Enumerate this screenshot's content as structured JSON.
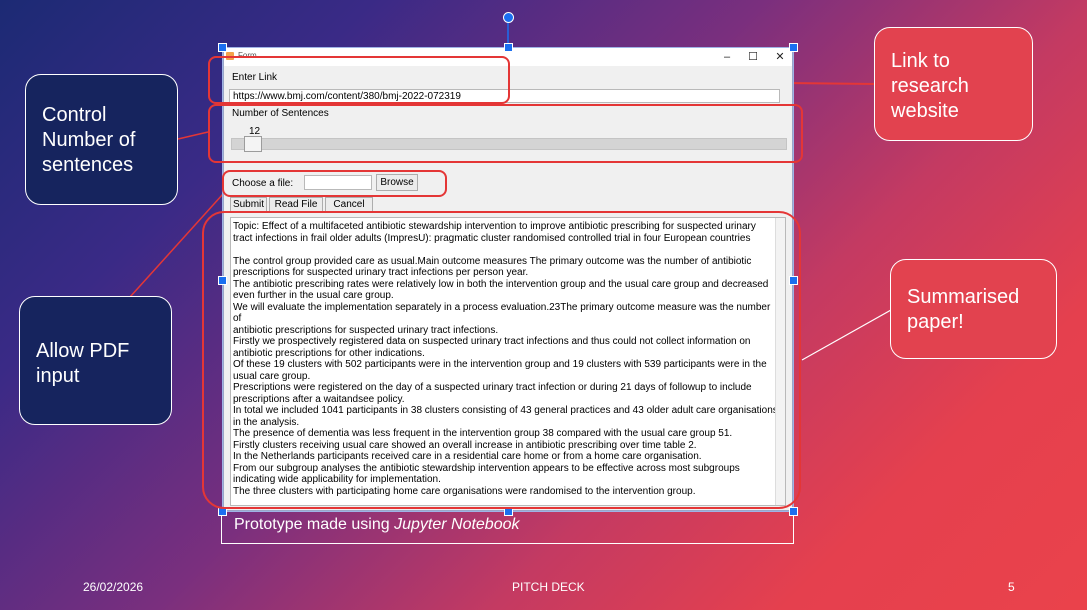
{
  "window": {
    "title": "Form",
    "minimize": "–",
    "maximize": "☐",
    "close": "✕"
  },
  "form": {
    "enter_link_label": "Enter Link",
    "link_value": "https://www.bmj.com/content/380/bmj-2022-072319",
    "sentences_label": "Number of Sentences",
    "sentences_value": "12",
    "choose_file_label": "Choose a file:",
    "file_value": "",
    "browse_label": "Browse",
    "submit_label": "Submit",
    "read_file_label": "Read File",
    "cancel_label": "Cancel",
    "output_text": "Topic: Effect of a multifaceted antibiotic stewardship intervention to improve antibiotic prescribing for suspected urinary\ntract infections in frail older adults (ImpresU): pragmatic cluster randomised controlled trial in four European countries\n\nThe control group provided care as usual.Main outcome measures The primary outcome was the number of antibiotic\nprescriptions for suspected urinary tract infections per person year.\nThe antibiotic prescribing rates were relatively low in both the intervention group and the usual care group and decreased\neven further in the usual care group.\nWe will evaluate the implementation separately in a process evaluation.23The primary outcome measure was the number of\nantibiotic prescriptions for suspected urinary tract infections.\nFirstly we prospectively registered data on suspected urinary tract infections and thus could not collect information on\nantibiotic prescriptions for other indications.\nOf these 19 clusters with 502 participants were in the intervention group and 19 clusters with 539 participants were in the\nusual care group.\nPrescriptions were registered on the day of a suspected urinary tract infection or during 21 days of followup to include\nprescriptions after a waitandsee policy.\nIn total we included 1041 participants in 38 clusters consisting of 43 general practices and 43 older adult care organisations\nin the analysis.\nThe presence of dementia was less frequent in the intervention group 38 compared with the usual care group 51.\nFirstly clusters receiving usual care showed an overall increase in antibiotic prescribing over time table 2.\nIn the Netherlands participants received care in a residential care home or from a home care organisation.\nFrom our subgroup analyses the antibiotic stewardship intervention appears to be effective across most subgroups\nindicating wide applicability for implementation.\nThe three clusters with participating home care organisations were randomised to the intervention group."
  },
  "caption": {
    "prefix": "Prototype made using ",
    "italic": "Jupyter Notebook"
  },
  "callouts": {
    "link": "Link to research website",
    "control": "Control Number of sentences",
    "pdf": "Allow PDF input",
    "summary": "Summarised paper!"
  },
  "footer": {
    "date": "26/02/2026",
    "title": "PITCH DECK",
    "page": "5"
  },
  "colors": {
    "highlight": "#e43636",
    "handle": "#1a6ff0",
    "callout_dark": "#16245e",
    "callout_red": "#e2424f"
  }
}
